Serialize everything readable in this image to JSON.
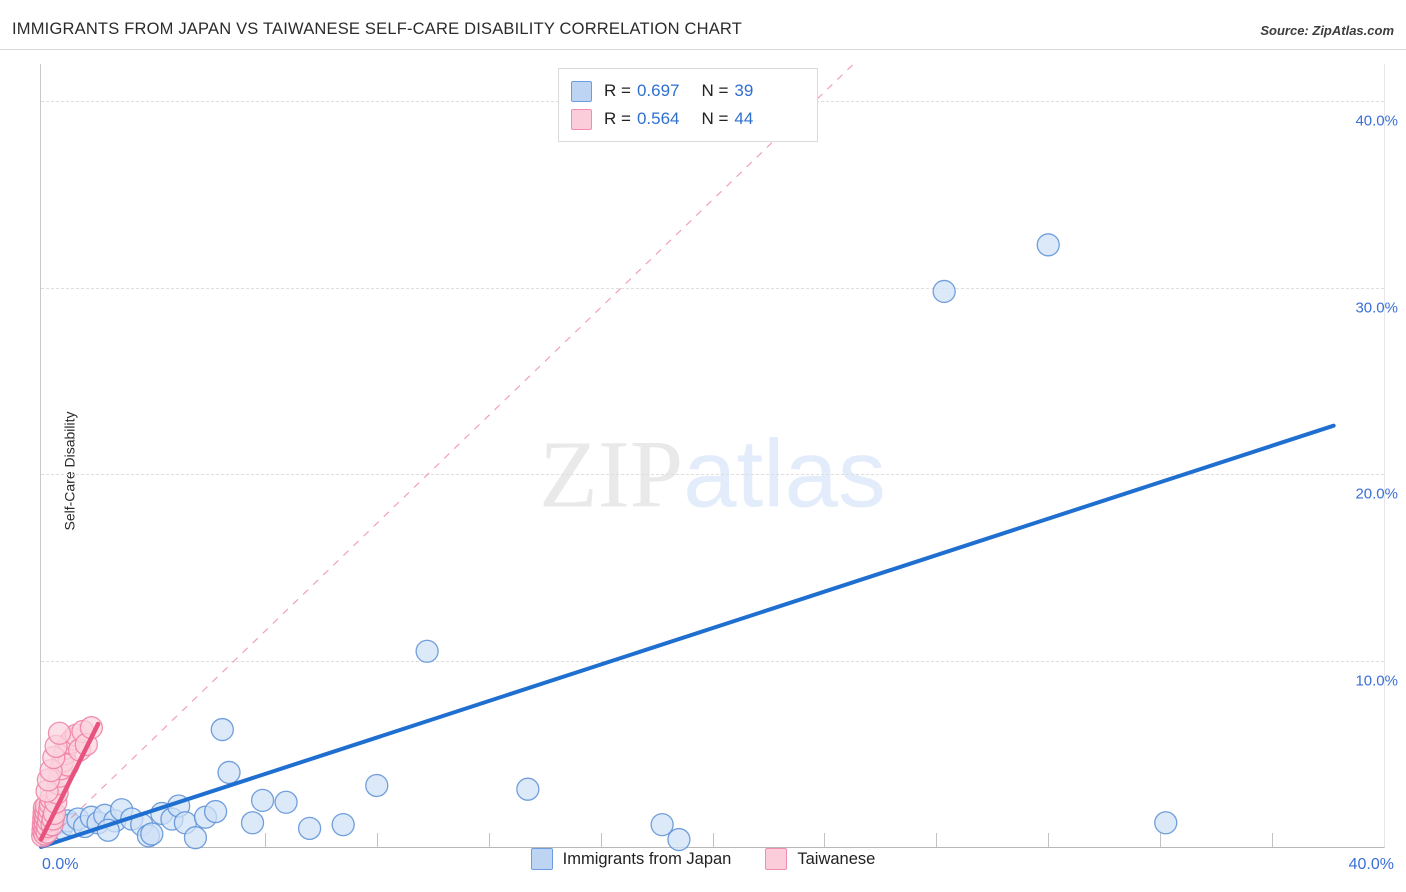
{
  "header": {
    "title": "IMMIGRANTS FROM JAPAN VS TAIWANESE SELF-CARE DISABILITY CORRELATION CHART",
    "source": "Source: ZipAtlas.com"
  },
  "watermark": {
    "part1": "ZIP",
    "part2": "atlas"
  },
  "stats": {
    "rows": [
      {
        "color": "blue",
        "r_label": "R =",
        "r_value": "0.697",
        "n_label": "N =",
        "n_value": "39"
      },
      {
        "color": "pink",
        "r_label": "R =",
        "r_value": "0.564",
        "n_label": "N =",
        "n_value": "44"
      }
    ]
  },
  "series_legend": [
    {
      "label": "Immigrants from Japan",
      "color": "blue"
    },
    {
      "label": "Taiwanese",
      "color": "pink"
    }
  ],
  "axes": {
    "y_title": "Self-Care Disability",
    "y_ticks": [
      "10.0%",
      "20.0%",
      "30.0%",
      "40.0%"
    ],
    "x_left": "0.0%",
    "x_right": "40.0%"
  },
  "colors": {
    "blue_fill": "#cfe0f7",
    "blue_stroke": "#5b8fd6",
    "blue_line": "#1f6fd0",
    "pink_fill": "#fbd3de",
    "pink_stroke": "#ef7fa4",
    "pink_line": "#e8527f",
    "tick_text": "#3a6fd8",
    "grid": "#dedede"
  },
  "chart_data": {
    "type": "scatter",
    "title": "IMMIGRANTS FROM JAPAN VS TAIWANESE SELF-CARE DISABILITY CORRELATION CHART",
    "xlabel": "",
    "ylabel": "Self-Care Disability",
    "xlim": [
      0.0,
      40.0
    ],
    "ylim": [
      0.0,
      42.0
    ],
    "x_ticks": [
      0.0,
      40.0
    ],
    "y_ticks": [
      10.0,
      20.0,
      30.0,
      40.0
    ],
    "grid": true,
    "legend_position": "bottom-center",
    "series": [
      {
        "name": "Immigrants from Japan",
        "color": "#cfe0f7",
        "r": 0.697,
        "n": 39,
        "trendline": {
          "type": "linear",
          "x0": 0.0,
          "y0": 0.0,
          "x1": 38.5,
          "y1": 22.6,
          "style": "solid"
        },
        "points": [
          [
            0.3,
            1.1
          ],
          [
            0.5,
            1.3
          ],
          [
            0.6,
            1.0
          ],
          [
            0.8,
            1.4
          ],
          [
            0.9,
            1.2
          ],
          [
            1.1,
            1.5
          ],
          [
            1.3,
            1.1
          ],
          [
            1.5,
            1.6
          ],
          [
            1.7,
            1.3
          ],
          [
            1.9,
            1.7
          ],
          [
            2.2,
            1.4
          ],
          [
            2.4,
            2.0
          ],
          [
            2.7,
            1.5
          ],
          [
            3.0,
            1.2
          ],
          [
            3.2,
            0.6
          ],
          [
            3.3,
            0.7
          ],
          [
            3.6,
            1.8
          ],
          [
            3.9,
            1.5
          ],
          [
            4.1,
            2.2
          ],
          [
            4.3,
            1.3
          ],
          [
            4.6,
            0.5
          ],
          [
            4.9,
            1.6
          ],
          [
            5.2,
            1.9
          ],
          [
            5.4,
            6.3
          ],
          [
            5.6,
            4.0
          ],
          [
            6.3,
            1.3
          ],
          [
            6.6,
            2.5
          ],
          [
            7.3,
            2.4
          ],
          [
            8.0,
            1.0
          ],
          [
            9.0,
            1.2
          ],
          [
            10.0,
            3.3
          ],
          [
            11.5,
            10.5
          ],
          [
            14.5,
            3.1
          ],
          [
            18.5,
            1.2
          ],
          [
            19.0,
            0.4
          ],
          [
            26.9,
            29.8
          ],
          [
            30.0,
            32.3
          ],
          [
            33.5,
            1.3
          ],
          [
            2.0,
            0.9
          ]
        ]
      },
      {
        "name": "Taiwanese",
        "color": "#fbd3de",
        "r": 0.564,
        "n": 44,
        "trendline": {
          "type": "linear",
          "x0": 0.0,
          "y0": 0.4,
          "x1": 1.7,
          "y1": 6.6,
          "style": "solid"
        },
        "reference_line": {
          "type": "linear",
          "x0": 0.0,
          "y0": 0.0,
          "x1": 24.2,
          "y1": 42.0,
          "style": "dashed"
        },
        "points": [
          [
            0.05,
            0.6
          ],
          [
            0.06,
            0.9
          ],
          [
            0.07,
            1.2
          ],
          [
            0.08,
            1.5
          ],
          [
            0.09,
            1.8
          ],
          [
            0.1,
            2.1
          ],
          [
            0.11,
            0.7
          ],
          [
            0.12,
            1.0
          ],
          [
            0.13,
            1.3
          ],
          [
            0.14,
            1.6
          ],
          [
            0.15,
            1.9
          ],
          [
            0.16,
            2.2
          ],
          [
            0.18,
            0.8
          ],
          [
            0.2,
            1.1
          ],
          [
            0.22,
            1.4
          ],
          [
            0.24,
            1.7
          ],
          [
            0.26,
            2.0
          ],
          [
            0.28,
            2.3
          ],
          [
            0.3,
            2.6
          ],
          [
            0.33,
            1.2
          ],
          [
            0.36,
            1.5
          ],
          [
            0.4,
            1.8
          ],
          [
            0.44,
            2.4
          ],
          [
            0.48,
            2.9
          ],
          [
            0.52,
            3.4
          ],
          [
            0.56,
            3.8
          ],
          [
            0.6,
            4.2
          ],
          [
            0.65,
            4.6
          ],
          [
            0.7,
            5.0
          ],
          [
            0.75,
            5.3
          ],
          [
            0.8,
            4.4
          ],
          [
            0.85,
            5.6
          ],
          [
            0.95,
            5.8
          ],
          [
            1.05,
            6.0
          ],
          [
            1.15,
            5.2
          ],
          [
            1.25,
            6.2
          ],
          [
            1.35,
            5.5
          ],
          [
            1.5,
            6.4
          ],
          [
            0.18,
            3.0
          ],
          [
            0.22,
            3.6
          ],
          [
            0.3,
            4.1
          ],
          [
            0.38,
            4.8
          ],
          [
            0.45,
            5.4
          ],
          [
            0.55,
            6.1
          ]
        ]
      }
    ]
  }
}
